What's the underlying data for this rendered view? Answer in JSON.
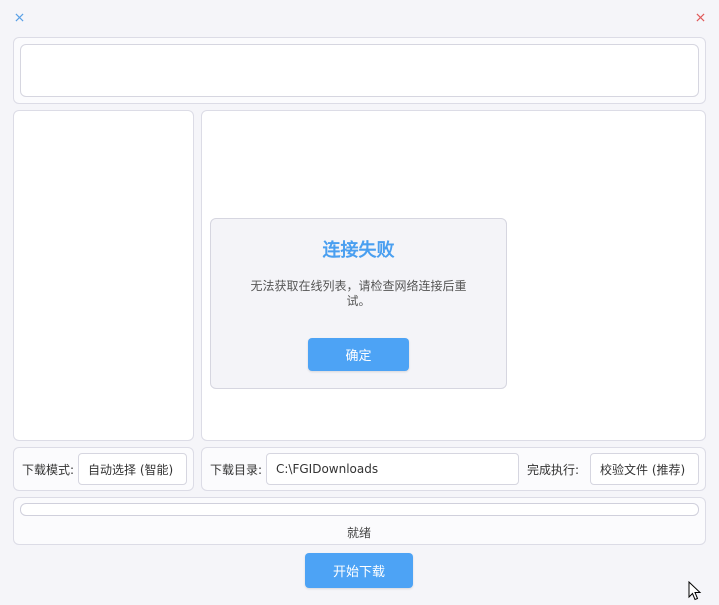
{
  "window": {
    "left_close_icon": "close-icon",
    "right_close_icon": "close-icon",
    "left_icon_color": "#5aa0e6",
    "right_icon_color": "#e05a5a"
  },
  "search_input": {
    "value": "",
    "placeholder": ""
  },
  "dialog": {
    "title": "连接失败",
    "message": "无法获取在线列表，请检查网络连接后重试。",
    "ok_label": "确定"
  },
  "options": {
    "mode_label": "下载模式:",
    "mode_value": "自动选择 (智能)",
    "dir_label": "下载目录:",
    "dir_value": "C:\\FGIDownloads",
    "after_label": "完成执行:",
    "after_value": "校验文件 (推荐)"
  },
  "progress": {
    "value": 0
  },
  "status_text": "就绪",
  "start_button_label": "开始下载",
  "colors": {
    "accent": "#4da3f5",
    "title": "#4a9ff0"
  }
}
